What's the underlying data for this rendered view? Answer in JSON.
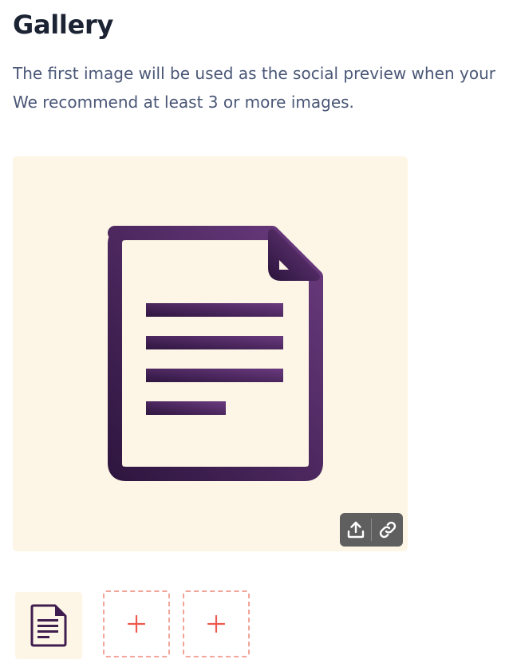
{
  "gallery": {
    "title": "Gallery",
    "description_line1": "The first image will be used as the social preview when your",
    "description_line2": "We recommend at least 3 or more images."
  },
  "main_preview": {
    "icon": "document-icon",
    "toolbar": {
      "upload_icon": "upload-icon",
      "link_icon": "link-icon"
    }
  },
  "thumbnails": {
    "items": [
      {
        "state": "filled",
        "icon": "document-icon"
      },
      {
        "state": "empty",
        "icon": "plus-icon"
      },
      {
        "state": "empty",
        "icon": "plus-icon"
      }
    ]
  },
  "colors": {
    "background_cream": "#fdf6e6",
    "document_purple": "#3f1d4f",
    "plus_red": "#ee5a4f",
    "dashed_border": "#f2a59b",
    "toolbar_gray": "#5f5f5f"
  }
}
